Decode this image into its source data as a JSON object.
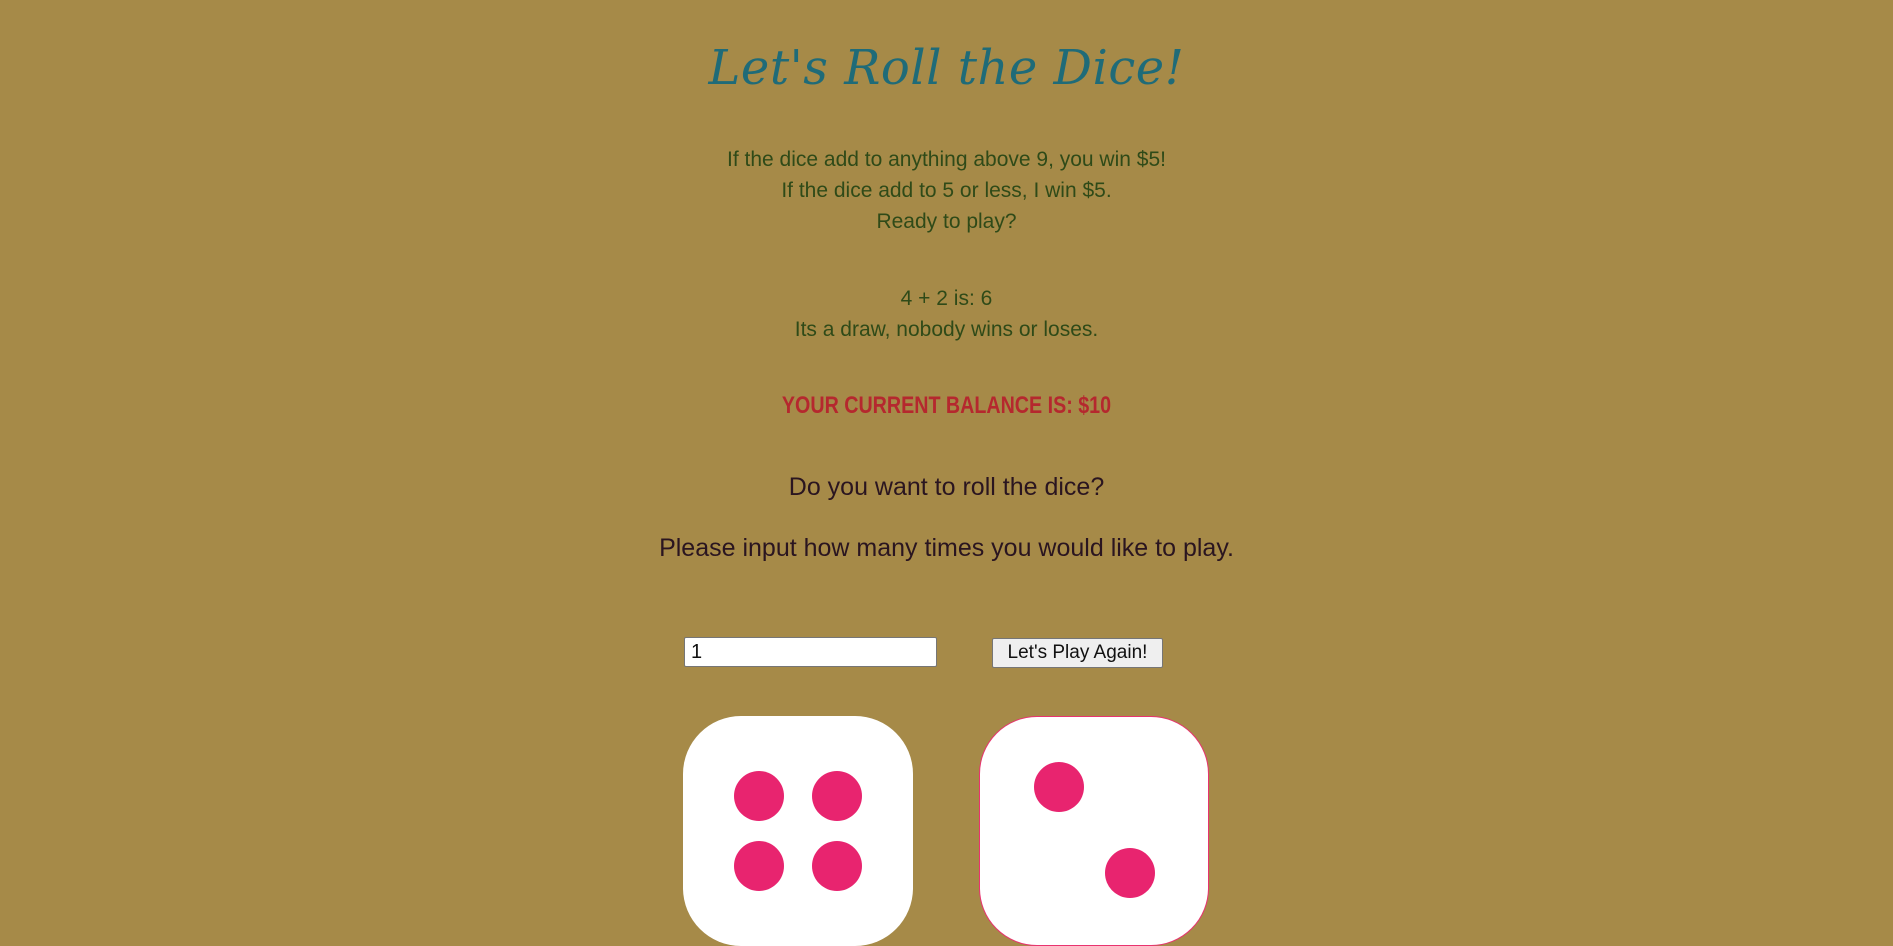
{
  "title": "Let's Roll the Dice!",
  "rules": {
    "line1": "If the dice add to anything above 9, you win $5!",
    "line2": "If the dice add to 5 or less, I win $5.",
    "line3": "Ready to play?"
  },
  "result": {
    "sum_line": "4 + 2 is: 6",
    "outcome": "Its a draw, nobody wins or loses."
  },
  "balance_text": "Your current balance is: $10",
  "question": "Do you want to roll the dice?",
  "prompt": "Please input how many times you would like to play.",
  "times_input": {
    "value": "1"
  },
  "play_button_label": "Let's Play Again!",
  "dice": {
    "left_value": 4,
    "right_value": 2
  },
  "colors": {
    "background": "#a68a48",
    "title": "#1f6b78",
    "balance": "#b5282e",
    "pip": "#e8246f"
  }
}
